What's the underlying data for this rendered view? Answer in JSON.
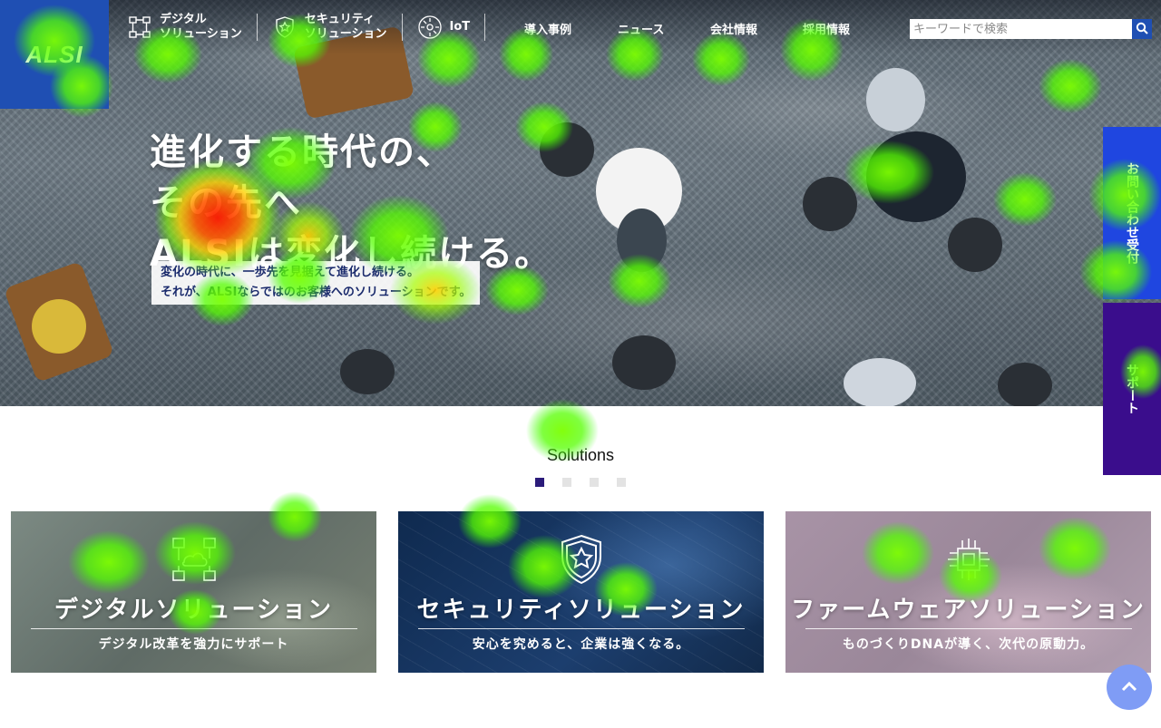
{
  "header": {
    "logo": "ALSI",
    "nav": [
      {
        "line1": "デジタル",
        "line2": "ソリューション",
        "icon": "network-icon"
      },
      {
        "line1": "セキュリティ",
        "line2": "ソリューション",
        "icon": "shield-star-icon"
      },
      {
        "line1": "IoT",
        "icon": "iot-icon"
      },
      {
        "label": "導入事例"
      },
      {
        "label": "ニュース"
      },
      {
        "label": "会社情報"
      },
      {
        "label": "採用情報"
      }
    ],
    "search": {
      "placeholder": "キーワードで検索",
      "icon": "search-icon"
    }
  },
  "hero": {
    "headline": [
      "進化する時代の、",
      "その先へ",
      "ALSIは変化し続ける。"
    ],
    "sub": [
      "変化の時代に、一歩先を見据えて進化し続ける。",
      "それが、ALSIならではのお客様へのソリューションです。"
    ]
  },
  "side_tabs": {
    "contact": "お問い合わせ受付",
    "support": "サポート"
  },
  "solutions": {
    "title": "Solutions",
    "active_slide": 1,
    "slide_count": 4,
    "cards": [
      {
        "title": "デジタルソリューション",
        "sub": "デジタル改革を強力にサポート",
        "icon": "digital-network-icon"
      },
      {
        "title": "セキュリティソリューション",
        "sub": "安心を究めると、企業は強くなる。",
        "icon": "shield-star-icon"
      },
      {
        "title": "ファームウェアソリューション",
        "sub": "ものづくりDNAが導く、次代の原動力。",
        "icon": "chip-icon"
      }
    ]
  },
  "colors": {
    "logo_bg": "#1f4fb3",
    "contact_tab": "#1f46e0",
    "support_tab": "#3a0d8c",
    "active_dot": "#2b1b7a",
    "back_to_top": "#7f9cf5"
  },
  "back_to_top": {
    "icon": "chevron-up-icon"
  }
}
